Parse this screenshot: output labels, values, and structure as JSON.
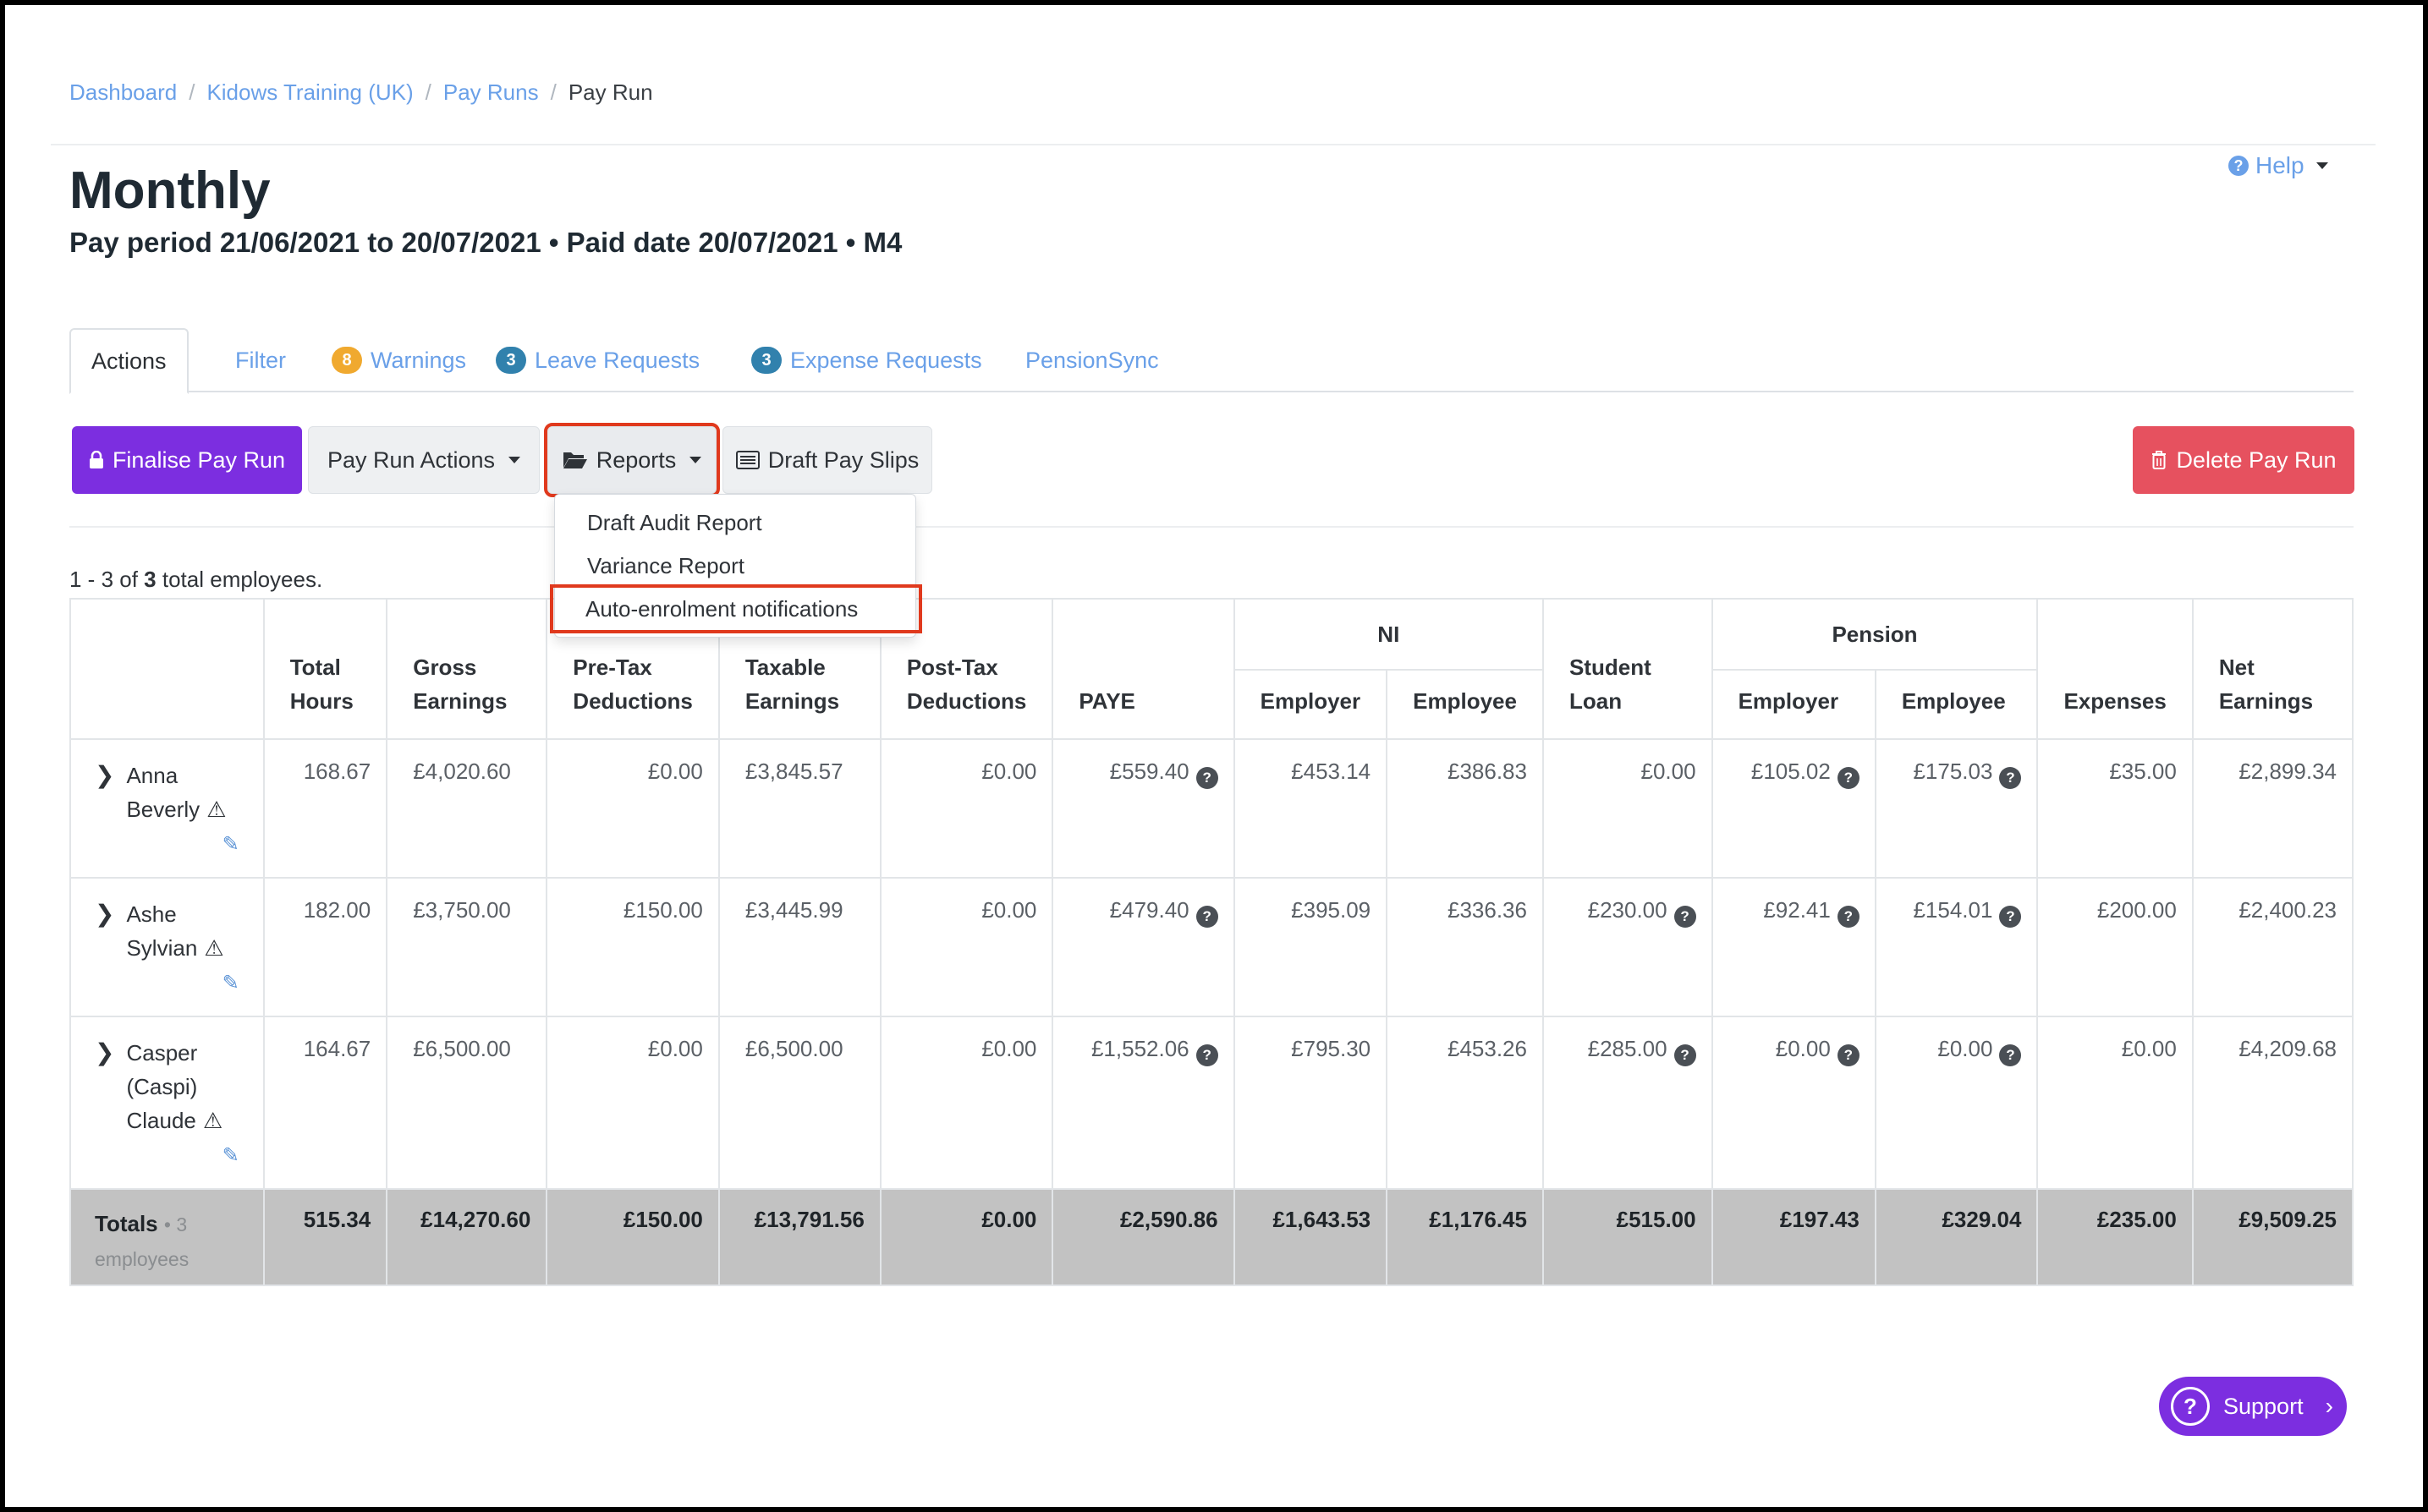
{
  "breadcrumb": {
    "items": [
      "Dashboard",
      "Kidows Training (UK)",
      "Pay Runs"
    ],
    "current": "Pay Run",
    "separator": "/"
  },
  "page": {
    "title": "Monthly",
    "subtitle": "Pay period 21/06/2021 to 20/07/2021 • Paid date 20/07/2021 • M4",
    "help_label": "Help"
  },
  "tabs": {
    "actions": "Actions",
    "filter": "Filter",
    "warnings": {
      "label": "Warnings",
      "count": "8"
    },
    "leave": {
      "label": "Leave Requests",
      "count": "3"
    },
    "expense": {
      "label": "Expense Requests",
      "count": "3"
    },
    "pensionsync": "PensionSync"
  },
  "toolbar": {
    "finalise": "Finalise Pay Run",
    "pay_run_actions": "Pay Run Actions",
    "reports": "Reports",
    "draft_pay_slips": "Draft Pay Slips",
    "delete": "Delete Pay Run"
  },
  "reports_menu": {
    "items": [
      "Draft Audit Report",
      "Variance Report",
      "Auto-enrolment notifications"
    ]
  },
  "count": {
    "prefix": "1 - 3 of",
    "total": "3",
    "suffix": "total employees."
  },
  "table": {
    "headers": {
      "total_hours": "Total Hours",
      "gross": "Gross Earnings",
      "pretax": "Pre-Tax Deductions",
      "taxable": "Taxable Earnings",
      "posttax": "Post-Tax Deductions",
      "paye": "PAYE",
      "ni": "NI",
      "ni_employer": "Employer",
      "ni_employee": "Employee",
      "student_loan": "Student Loan",
      "pension": "Pension",
      "pension_employer": "Employer",
      "pension_employee": "Employee",
      "expenses": "Expenses",
      "net": "Net Earnings"
    },
    "rows": [
      {
        "name_lines": [
          "Anna",
          "Beverly"
        ],
        "hours": "168.67",
        "gross": "£4,020.60",
        "pretax": "£0.00",
        "taxable": "£3,845.57",
        "posttax": "£0.00",
        "paye": "£559.40",
        "ni_er": "£453.14",
        "ni_ee": "£386.83",
        "sl": "£0.00",
        "pen_er": "£105.02",
        "pen_ee": "£175.03",
        "exp": "£35.00",
        "net": "£2,899.34"
      },
      {
        "name_lines": [
          "Ashe",
          "Sylvian"
        ],
        "hours": "182.00",
        "gross": "£3,750.00",
        "pretax": "£150.00",
        "taxable": "£3,445.99",
        "posttax": "£0.00",
        "paye": "£479.40",
        "ni_er": "£395.09",
        "ni_ee": "£336.36",
        "sl": "£230.00",
        "pen_er": "£92.41",
        "pen_ee": "£154.01",
        "exp": "£200.00",
        "net": "£2,400.23"
      },
      {
        "name_lines": [
          "Casper",
          "(Caspi)",
          "Claude"
        ],
        "hours": "164.67",
        "gross": "£6,500.00",
        "pretax": "£0.00",
        "taxable": "£6,500.00",
        "posttax": "£0.00",
        "paye": "£1,552.06",
        "ni_er": "£795.30",
        "ni_ee": "£453.26",
        "sl": "£285.00",
        "pen_er": "£0.00",
        "pen_ee": "£0.00",
        "exp": "£0.00",
        "net": "£4,209.68"
      }
    ],
    "totals": {
      "label": "Totals",
      "sub": "• 3",
      "sub2": "employees",
      "hours": "515.34",
      "gross": "£14,270.60",
      "pretax": "£150.00",
      "taxable": "£13,791.56",
      "posttax": "£0.00",
      "paye": "£2,590.86",
      "ni_er": "£1,643.53",
      "ni_ee": "£1,176.45",
      "sl": "£515.00",
      "pen_er": "£197.43",
      "pen_ee": "£329.04",
      "exp": "£235.00",
      "net": "£9,509.25"
    }
  },
  "support": {
    "label": "Support"
  },
  "colors": {
    "accent_purple": "#7c2ee0",
    "danger": "#e6515f",
    "link": "#6aa0e8",
    "highlight_outline": "#e0391d",
    "badge_orange": "#f0a92f",
    "badge_blue": "#3181ad"
  }
}
